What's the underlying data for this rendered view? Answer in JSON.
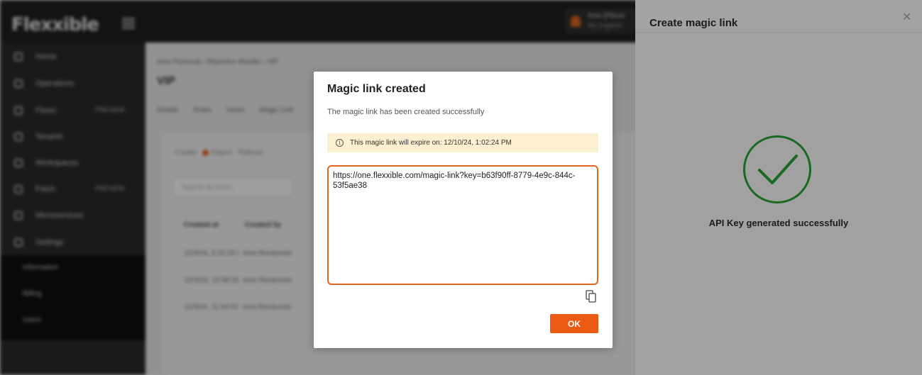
{
  "app": {
    "logo": "Flexxible",
    "user": {
      "name": "Inno (Flexxi",
      "org": "My organiz"
    },
    "sidebar": {
      "items": [
        {
          "label": "Home",
          "badge": ""
        },
        {
          "label": "Operations",
          "badge": ""
        },
        {
          "label": "Flows",
          "badge": "PREVIEW"
        },
        {
          "label": "Tenants",
          "badge": ""
        },
        {
          "label": "Workspaces",
          "badge": ""
        },
        {
          "label": "Patch",
          "badge": "PREVIEW"
        },
        {
          "label": "Microservices",
          "badge": ""
        },
        {
          "label": "Settings",
          "badge": ""
        }
      ],
      "sub_items": [
        "Information",
        "Billing",
        "Users"
      ]
    },
    "content": {
      "breadcrumb": "Inno Personal  ›  Reportes ebooks  ›  VIP",
      "title": "VIP",
      "tabs": [
        "Details",
        "Roles",
        "Users",
        "Magic Link"
      ],
      "toolbar": {
        "create": "Create",
        "export": "Export",
        "refresh": "Refresh"
      },
      "search_placeholder": "Search by term...",
      "columns": [
        "Created at",
        "Created by"
      ],
      "rows": [
        {
          "date": "12/3/24, 3:32:24 I",
          "by": "Inno Recauvsio"
        },
        {
          "date": "12/3/24, 12:08:31",
          "by": "Inno Recauvsio"
        },
        {
          "date": "12/3/24, 11:04:51",
          "by": "Inno Recauvsio"
        }
      ]
    }
  },
  "drawer": {
    "title": "Create magic link",
    "close_icon": "close-icon",
    "status_icon": "check-circle-icon",
    "success_message": "API Key generated successfully",
    "success_color": "#176a20"
  },
  "modal": {
    "title": "Magic link created",
    "subtitle": "The magic link has been created successfully",
    "notice_icon": "info-icon",
    "notice_text": "This magic link will expire on: 12/10/24, 1:02:24 PM",
    "link_value": "https://one.flexxible.com/magic-link?key=b63f90ff-8779-4e9c-844c-53f5ae38",
    "copy_icon": "copy-icon",
    "ok_label": "OK",
    "accent_color": "#ec5b13",
    "notice_bg": "#fbf0d1"
  }
}
